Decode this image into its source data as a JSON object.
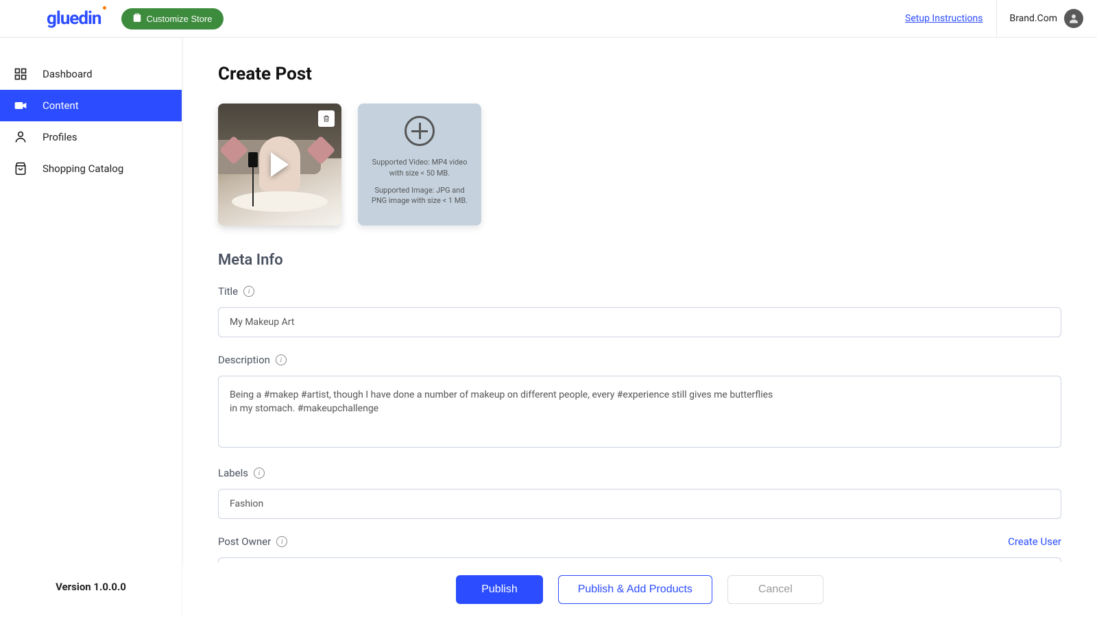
{
  "header": {
    "logo": "gluedin",
    "customize_button": "Customize Store",
    "setup_link": "Setup Instructions",
    "brand_name": "Brand.Com"
  },
  "sidebar": {
    "items": [
      {
        "label": "Dashboard",
        "active": false
      },
      {
        "label": "Content",
        "active": true
      },
      {
        "label": "Profiles",
        "active": false
      },
      {
        "label": "Shopping Catalog",
        "active": false
      }
    ],
    "version": "Version 1.0.0.0"
  },
  "main": {
    "page_title": "Create Post",
    "upload": {
      "video_hint": "Supported Video: MP4 video with size < 50 MB.",
      "image_hint": "Supported Image: JPG and PNG image with size < 1 MB."
    },
    "meta_section_title": "Meta Info",
    "fields": {
      "title_label": "Title",
      "title_value": "My Makeup Art",
      "description_label": "Description",
      "description_value": "Being a #makep #artist, though I have done a number of makeup on different people, every #experience still gives me butterflies\nin my stomach. #makeupchallenge",
      "labels_label": "Labels",
      "labels_value": "Fashion",
      "post_owner_label": "Post Owner",
      "create_user_link": "Create User"
    }
  },
  "footer": {
    "publish": "Publish",
    "publish_add": "Publish & Add Products",
    "cancel": "Cancel"
  }
}
